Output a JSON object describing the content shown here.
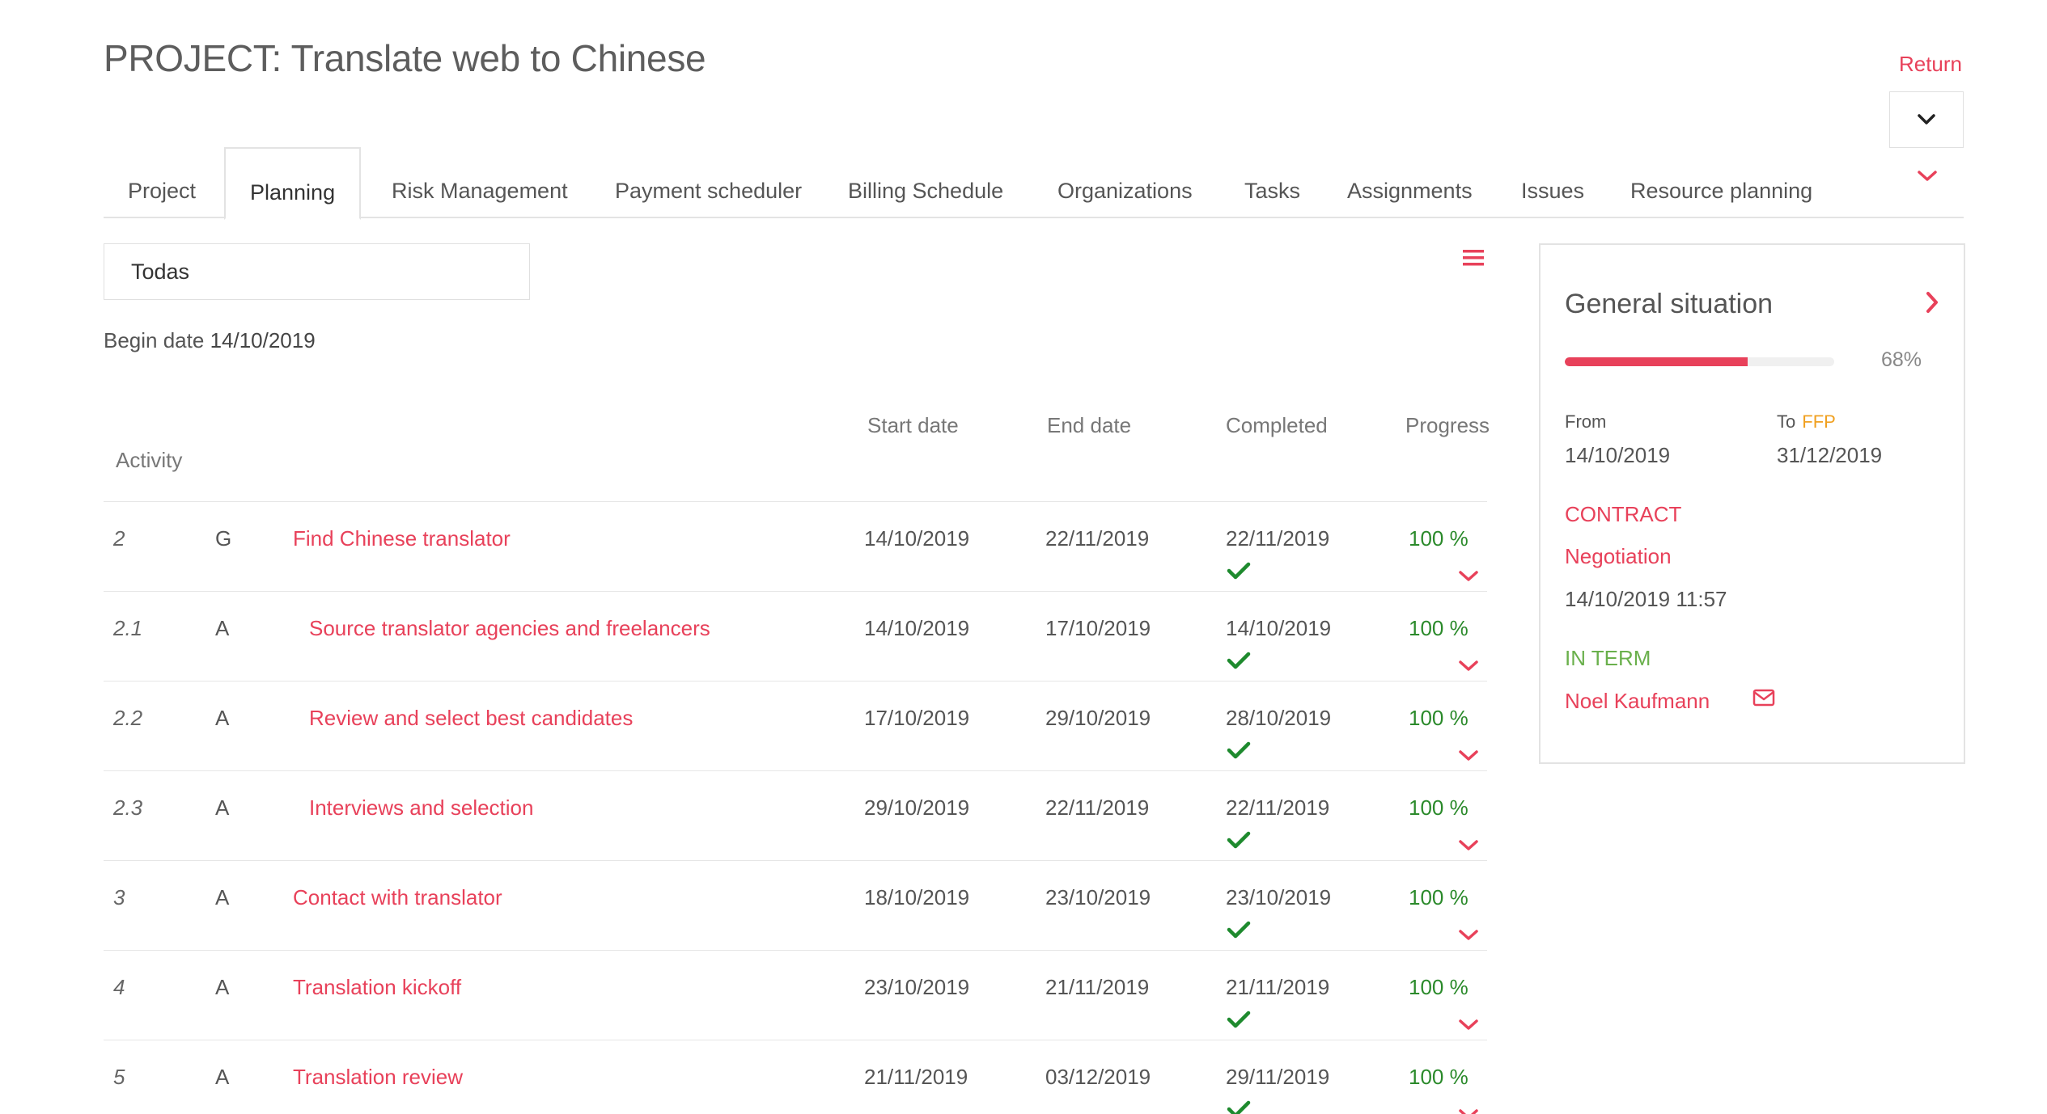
{
  "header": {
    "title": "PROJECT: Translate web to Chinese",
    "return_label": "Return"
  },
  "tabs": [
    {
      "label": "Project"
    },
    {
      "label": "Planning",
      "active": true
    },
    {
      "label": "Risk Management"
    },
    {
      "label": "Payment scheduler"
    },
    {
      "label": "Billing Schedule"
    },
    {
      "label": "Organizations"
    },
    {
      "label": "Tasks"
    },
    {
      "label": "Assignments"
    },
    {
      "label": "Issues"
    },
    {
      "label": "Resource planning"
    }
  ],
  "filter": {
    "selected": "Todas"
  },
  "begin": {
    "label": "Begin date",
    "date": "14/10/2019"
  },
  "table": {
    "headers": {
      "activity": "Activity",
      "start": "Start date",
      "end": "End date",
      "completed": "Completed",
      "progress": "Progress"
    },
    "rows": [
      {
        "num": "2",
        "type": "G",
        "name": "Find Chinese translator",
        "start": "14/10/2019",
        "end": "22/11/2019",
        "completed": "22/11/2019",
        "progress": "100 %",
        "indent": false
      },
      {
        "num": "2.1",
        "type": "A",
        "name": "Source translator agencies and freelancers",
        "start": "14/10/2019",
        "end": "17/10/2019",
        "completed": "14/10/2019",
        "progress": "100 %",
        "indent": true
      },
      {
        "num": "2.2",
        "type": "A",
        "name": "Review and select best candidates",
        "start": "17/10/2019",
        "end": "29/10/2019",
        "completed": "28/10/2019",
        "progress": "100 %",
        "indent": true
      },
      {
        "num": "2.3",
        "type": "A",
        "name": "Interviews and selection",
        "start": "29/10/2019",
        "end": "22/11/2019",
        "completed": "22/11/2019",
        "progress": "100 %",
        "indent": true
      },
      {
        "num": "3",
        "type": "A",
        "name": "Contact with translator",
        "start": "18/10/2019",
        "end": "23/10/2019",
        "completed": "23/10/2019",
        "progress": "100 %",
        "indent": false
      },
      {
        "num": "4",
        "type": "A",
        "name": "Translation kickoff",
        "start": "23/10/2019",
        "end": "21/11/2019",
        "completed": "21/11/2019",
        "progress": "100 %",
        "indent": false
      },
      {
        "num": "5",
        "type": "A",
        "name": "Translation review",
        "start": "21/11/2019",
        "end": "03/12/2019",
        "completed": "29/11/2019",
        "progress": "100 %",
        "indent": false
      }
    ]
  },
  "panel": {
    "title": "General situation",
    "progress_fraction": 0.68,
    "progress_label": "68%",
    "from_label": "From",
    "from_value": "14/10/2019",
    "to_label": "To",
    "to_badge": "FFP",
    "to_value": "31/12/2019",
    "contract_label": "CONTRACT",
    "contract_status": "Negotiation",
    "contract_date": "14/10/2019 11:57",
    "term_label": "IN TERM",
    "owner": "Noel Kaufmann"
  },
  "colors": {
    "accent": "#e8415a",
    "success": "#2b8a2b",
    "term": "#6ab04c",
    "ffp": "#f0a020"
  }
}
